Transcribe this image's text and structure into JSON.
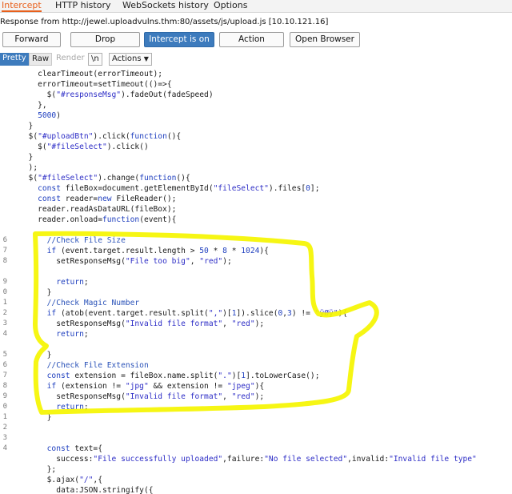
{
  "tabs": [
    "Intercept",
    "HTTP history",
    "WebSockets history",
    "Options"
  ],
  "response_info": "Response from http://jewel.uploadvulns.thm:80/assets/js/upload.js  [10.10.121.16]",
  "toolbar": {
    "forward": "Forward",
    "drop": "Drop",
    "intercept": "Intercept is on",
    "action": "Action",
    "open_browser": "Open Browser"
  },
  "view": {
    "pretty": "Pretty",
    "raw": "Raw",
    "render": "Render",
    "newline": "\\n",
    "actions": "Actions",
    "actions_icon": "chevron-down-icon"
  },
  "accent_color": "#e8601c",
  "highlight_color": "#f5f500",
  "code_lines": [
    {
      "n": "",
      "t": "    clearTimeout(errorTimeout);"
    },
    {
      "n": "",
      "t": "    errorTimeout=setTimeout(()=>{"
    },
    {
      "n": "",
      "t": "      $(\"#responseMsg\").fadeOut(fadeSpeed)"
    },
    {
      "n": "",
      "t": "    },"
    },
    {
      "n": "",
      "t": "    5000)"
    },
    {
      "n": "",
      "t": "  }"
    },
    {
      "n": "",
      "t": "  $(\"#uploadBtn\").click(function(){"
    },
    {
      "n": "",
      "t": "    $(\"#fileSelect\").click()"
    },
    {
      "n": "",
      "t": "  }"
    },
    {
      "n": "",
      "t": "  );"
    },
    {
      "n": "",
      "t": "  $(\"#fileSelect\").change(function(){"
    },
    {
      "n": "",
      "t": "    const fileBox=document.getElementById(\"fileSelect\").files[0];"
    },
    {
      "n": "",
      "t": "    const reader=new FileReader();"
    },
    {
      "n": "",
      "t": "    reader.readAsDataURL(fileBox);"
    },
    {
      "n": "",
      "t": "    reader.onload=function(event){"
    },
    {
      "n": "",
      "t": ""
    },
    {
      "n": "6",
      "t": "      //Check File Size"
    },
    {
      "n": "7",
      "t": "      if (event.target.result.length > 50 * 8 * 1024){"
    },
    {
      "n": "8",
      "t": "        setResponseMsg(\"File too big\", \"red\");"
    },
    {
      "n": "",
      "t": ""
    },
    {
      "n": "9",
      "t": "        return;"
    },
    {
      "n": "0",
      "t": "      }"
    },
    {
      "n": "1",
      "t": "      //Check Magic Number"
    },
    {
      "n": "2",
      "t": "      if (atob(event.target.result.split(\",\")[1]).slice(0,3) != \"ÿØÿ\"){"
    },
    {
      "n": "3",
      "t": "        setResponseMsg(\"Invalid file format\", \"red\");"
    },
    {
      "n": "4",
      "t": "        return;"
    },
    {
      "n": "",
      "t": ""
    },
    {
      "n": "5",
      "t": "      }"
    },
    {
      "n": "6",
      "t": "      //Check File Extension"
    },
    {
      "n": "7",
      "t": "      const extension = fileBox.name.split(\".\")[1].toLowerCase();"
    },
    {
      "n": "8",
      "t": "      if (extension != \"jpg\" && extension != \"jpeg\"){"
    },
    {
      "n": "9",
      "t": "        setResponseMsg(\"Invalid file format\", \"red\");"
    },
    {
      "n": "0",
      "t": "        return;"
    },
    {
      "n": "1",
      "t": "      }"
    },
    {
      "n": "2",
      "t": ""
    },
    {
      "n": "3",
      "t": ""
    },
    {
      "n": "4",
      "t": "      const text={"
    },
    {
      "n": "",
      "t": "        success:\"File successfully uploaded\",failure:\"No file selected\",invalid:\"Invalid file type\""
    },
    {
      "n": "",
      "t": "      };"
    },
    {
      "n": "",
      "t": "      $.ajax(\"/\",{"
    },
    {
      "n": "",
      "t": "        data:JSON.stringify({"
    }
  ]
}
